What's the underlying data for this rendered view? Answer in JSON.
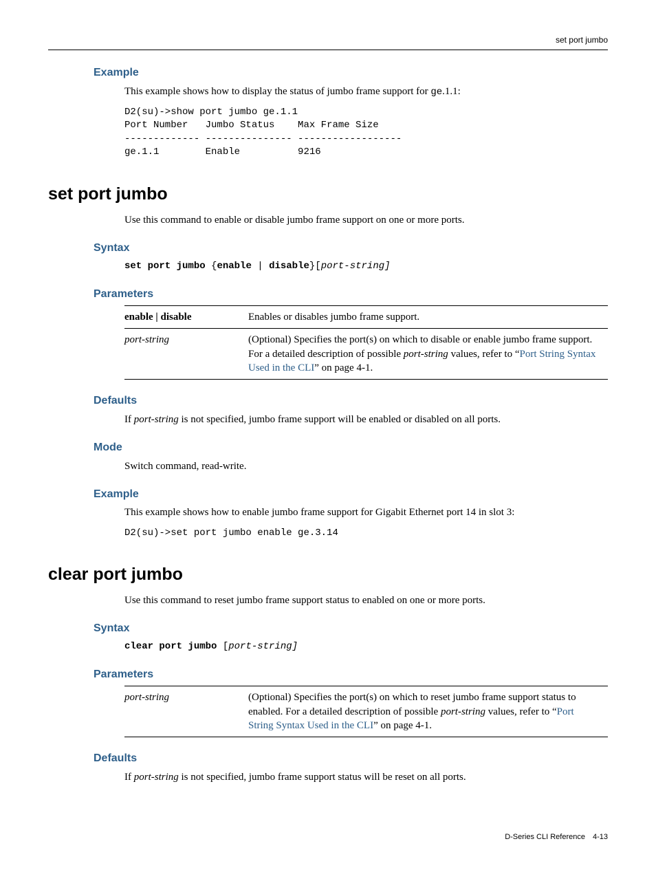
{
  "header": {
    "right": "set port jumbo"
  },
  "sec1": {
    "example_h": "Example",
    "example_intro_a": "This example shows how to display the status of jumbo frame support for ",
    "example_intro_code": "ge",
    "example_intro_b": ".1.1:",
    "code": "D2(su)->show port jumbo ge.1.1\nPort Number   Jumbo Status    Max Frame Size\n------------- --------------- ------------------\nge.1.1        Enable          9216"
  },
  "sec2": {
    "title": "set port jumbo",
    "intro": "Use this command to enable or disable jumbo frame support on one or more ports.",
    "syntax_h": "Syntax",
    "syntax_cmd": "set port jumbo",
    "syntax_open": " {",
    "syntax_en": "enable",
    "syntax_bar": " | ",
    "syntax_dis": "disable",
    "syntax_close": "}[",
    "syntax_ps": "port-string]",
    "params_h": "Parameters",
    "p1_name": "enable | disable",
    "p1_desc": "Enables or disables jumbo frame support.",
    "p2_name": "port-string",
    "p2_desc_a": "(Optional) Specifies the port(s) on which to disable or enable jumbo frame support. For a detailed description of possible ",
    "p2_desc_i": "port-string",
    "p2_desc_b": " values, refer to “",
    "p2_link": "Port String Syntax Used in the CLI",
    "p2_desc_c": "” on page 4-1.",
    "defaults_h": "Defaults",
    "defaults_a": "If ",
    "defaults_i": "port-string",
    "defaults_b": " is not specified, jumbo frame support will be enabled or disabled on all ports.",
    "mode_h": "Mode",
    "mode_t": "Switch command, read-write.",
    "example_h": "Example",
    "example_t": "This example shows how to enable jumbo frame support for Gigabit Ethernet port 14 in slot 3:",
    "example_code": "D2(su)->set port jumbo enable ge.3.14"
  },
  "sec3": {
    "title": "clear port jumbo",
    "intro": "Use this command to reset jumbo frame support status to enabled on one or more ports.",
    "syntax_h": "Syntax",
    "syntax_cmd": "clear port jumbo",
    "syntax_open": " [",
    "syntax_ps": "port-string]",
    "params_h": "Parameters",
    "p1_name": "port-string",
    "p1_desc_a": "(Optional) Specifies the port(s) on which to reset jumbo frame support status to enabled. For a detailed description of possible ",
    "p1_desc_i": "port-string",
    "p1_desc_b": " values, refer to “",
    "p1_link": "Port String Syntax Used in the CLI",
    "p1_desc_c": "” on page 4-1.",
    "defaults_h": "Defaults",
    "defaults_a": "If ",
    "defaults_i": "port-string",
    "defaults_b": " is not specified, jumbo frame support status will be reset on all ports."
  },
  "footer": {
    "book": "D-Series CLI Reference",
    "sep": " ",
    "page": "4-13"
  }
}
